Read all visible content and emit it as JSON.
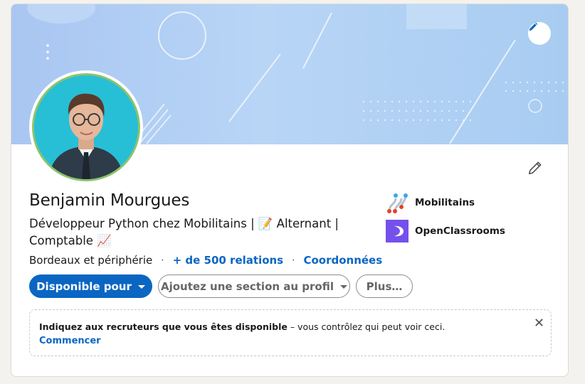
{
  "profile": {
    "name": "Benjamin Mourgues",
    "headline_part1": "Développeur Python chez Mobilitains | ",
    "headline_emoji1": "📝",
    "headline_part2": " Alternant | Comptable ",
    "headline_emoji2": "📈",
    "location": "Bordeaux et périphérie",
    "separator": "·",
    "relations": "+ de 500 relations",
    "contact": "Coordonnées"
  },
  "companies": [
    {
      "name": "Mobilitains",
      "icon": "mobilitains-logo-icon"
    },
    {
      "name": "OpenClassrooms",
      "icon": "openclassrooms-logo-icon"
    }
  ],
  "actions": {
    "available_for": "Disponible pour",
    "add_section": "Ajoutez une section au profil",
    "more": "Plus…"
  },
  "notice": {
    "bold_text": "Indiquez aux recruteurs que vous êtes disponible",
    "rest_text": " – vous contrôlez qui peut voir ceci.",
    "action": "Commencer"
  },
  "colors": {
    "primary": "#0a66c2",
    "banner": "#b8d5f6",
    "avatar_bg": "#2fc4d9",
    "openclassrooms": "#7451eb"
  }
}
